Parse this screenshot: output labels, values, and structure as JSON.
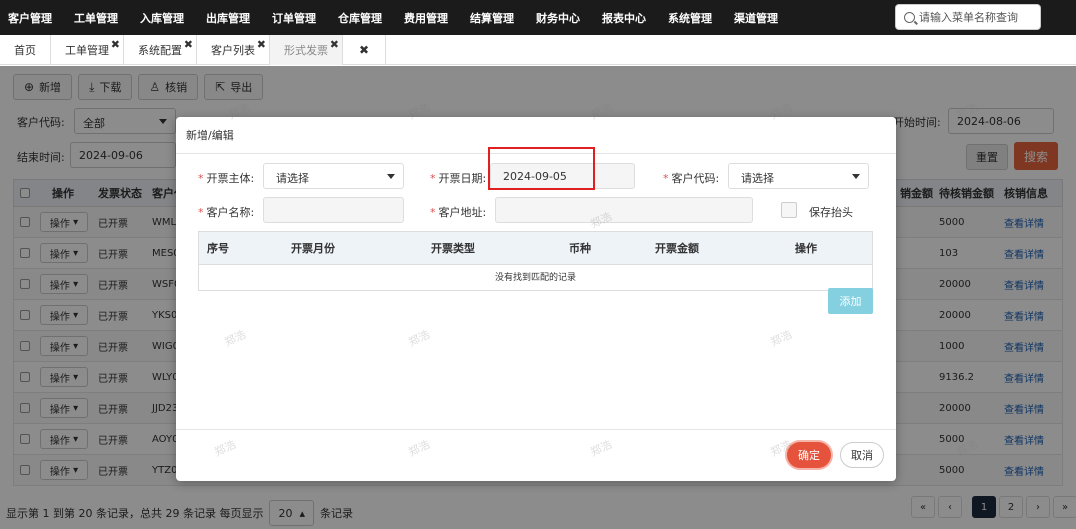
{
  "topnav": {
    "items": [
      "客户管理",
      "工单管理",
      "入库管理",
      "出库管理",
      "订单管理",
      "仓库管理",
      "费用管理",
      "结算管理",
      "财务中心",
      "报表中心",
      "系统管理",
      "渠道管理"
    ],
    "search_placeholder": "请输入菜单名称查询"
  },
  "tabs": [
    {
      "label": "首页",
      "closable": false
    },
    {
      "label": "工单管理",
      "closable": true
    },
    {
      "label": "系统配置",
      "closable": true
    },
    {
      "label": "客户列表",
      "closable": true
    },
    {
      "label": "形式发票",
      "closable": true,
      "active": true
    },
    {
      "label": "✖",
      "closable": false
    }
  ],
  "toolbar": {
    "add": "新增",
    "download": "下载",
    "verify": "核销",
    "export": "导出"
  },
  "filters": {
    "customer_code_label": "客户代码:",
    "customer_code_value": "全部",
    "start_time_label": "开始时间:",
    "start_time_value": "2024-08-06",
    "end_time_label": "结束时间:",
    "end_time_value": "2024-09-06",
    "reset": "重置",
    "search": "搜索"
  },
  "table": {
    "headers": {
      "op": "操作",
      "status": "发票状态",
      "customer": "客户代",
      "amount_partial": "销金额",
      "pending": "待核销金额",
      "verify_info": "核销信息"
    },
    "rows": [
      {
        "op": "操作",
        "status": "已开票",
        "code": "WML5",
        "pending": "5000",
        "link": "查看详情"
      },
      {
        "op": "操作",
        "status": "已开票",
        "code": "MES0",
        "pending": "103",
        "link": "查看详情"
      },
      {
        "op": "操作",
        "status": "已开票",
        "code": "WSF0",
        "pending": "20000",
        "link": "查看详情"
      },
      {
        "op": "操作",
        "status": "已开票",
        "code": "YKS01",
        "pending": "20000",
        "link": "查看详情"
      },
      {
        "op": "操作",
        "status": "已开票",
        "code": "WIG0",
        "pending": "1000",
        "link": "查看详情"
      },
      {
        "op": "操作",
        "status": "已开票",
        "code": "WLY0",
        "pending": "9136.2",
        "link": "查看详情"
      },
      {
        "op": "操作",
        "status": "已开票",
        "code": "JJD23",
        "pending": "20000",
        "link": "查看详情"
      },
      {
        "op": "操作",
        "status": "已开票",
        "code": "AOY0",
        "pending": "5000",
        "link": "查看详情"
      },
      {
        "op": "操作",
        "status": "已开票",
        "code": "YTZ02",
        "pending": "5000",
        "link": "查看详情"
      }
    ]
  },
  "footer": {
    "summary": "显示第 1 到第 20 条记录，总共 29 条记录 每页显示",
    "page_size": "20",
    "suffix": "条记录",
    "pages": [
      "«",
      "‹",
      "1",
      "2",
      "›",
      "»"
    ],
    "active_page": "1"
  },
  "modal": {
    "title": "新增/编辑",
    "invoice_entity_label": "开票主体:",
    "invoice_entity_value": "请选择",
    "invoice_date_label": "开票日期:",
    "invoice_date_value": "2024-09-05",
    "customer_code_label": "客户代码:",
    "customer_code_value": "请选择",
    "customer_name_label": "客户名称:",
    "customer_address_label": "客户地址:",
    "save_header_label": "保存抬头",
    "columns": [
      "序号",
      "开票月份",
      "开票类型",
      "币种",
      "开票金额",
      "操作"
    ],
    "empty_text": "没有找到匹配的记录",
    "add_button": "添加",
    "ok_button": "确定",
    "cancel_button": "取消"
  },
  "watermark": "郑浩"
}
